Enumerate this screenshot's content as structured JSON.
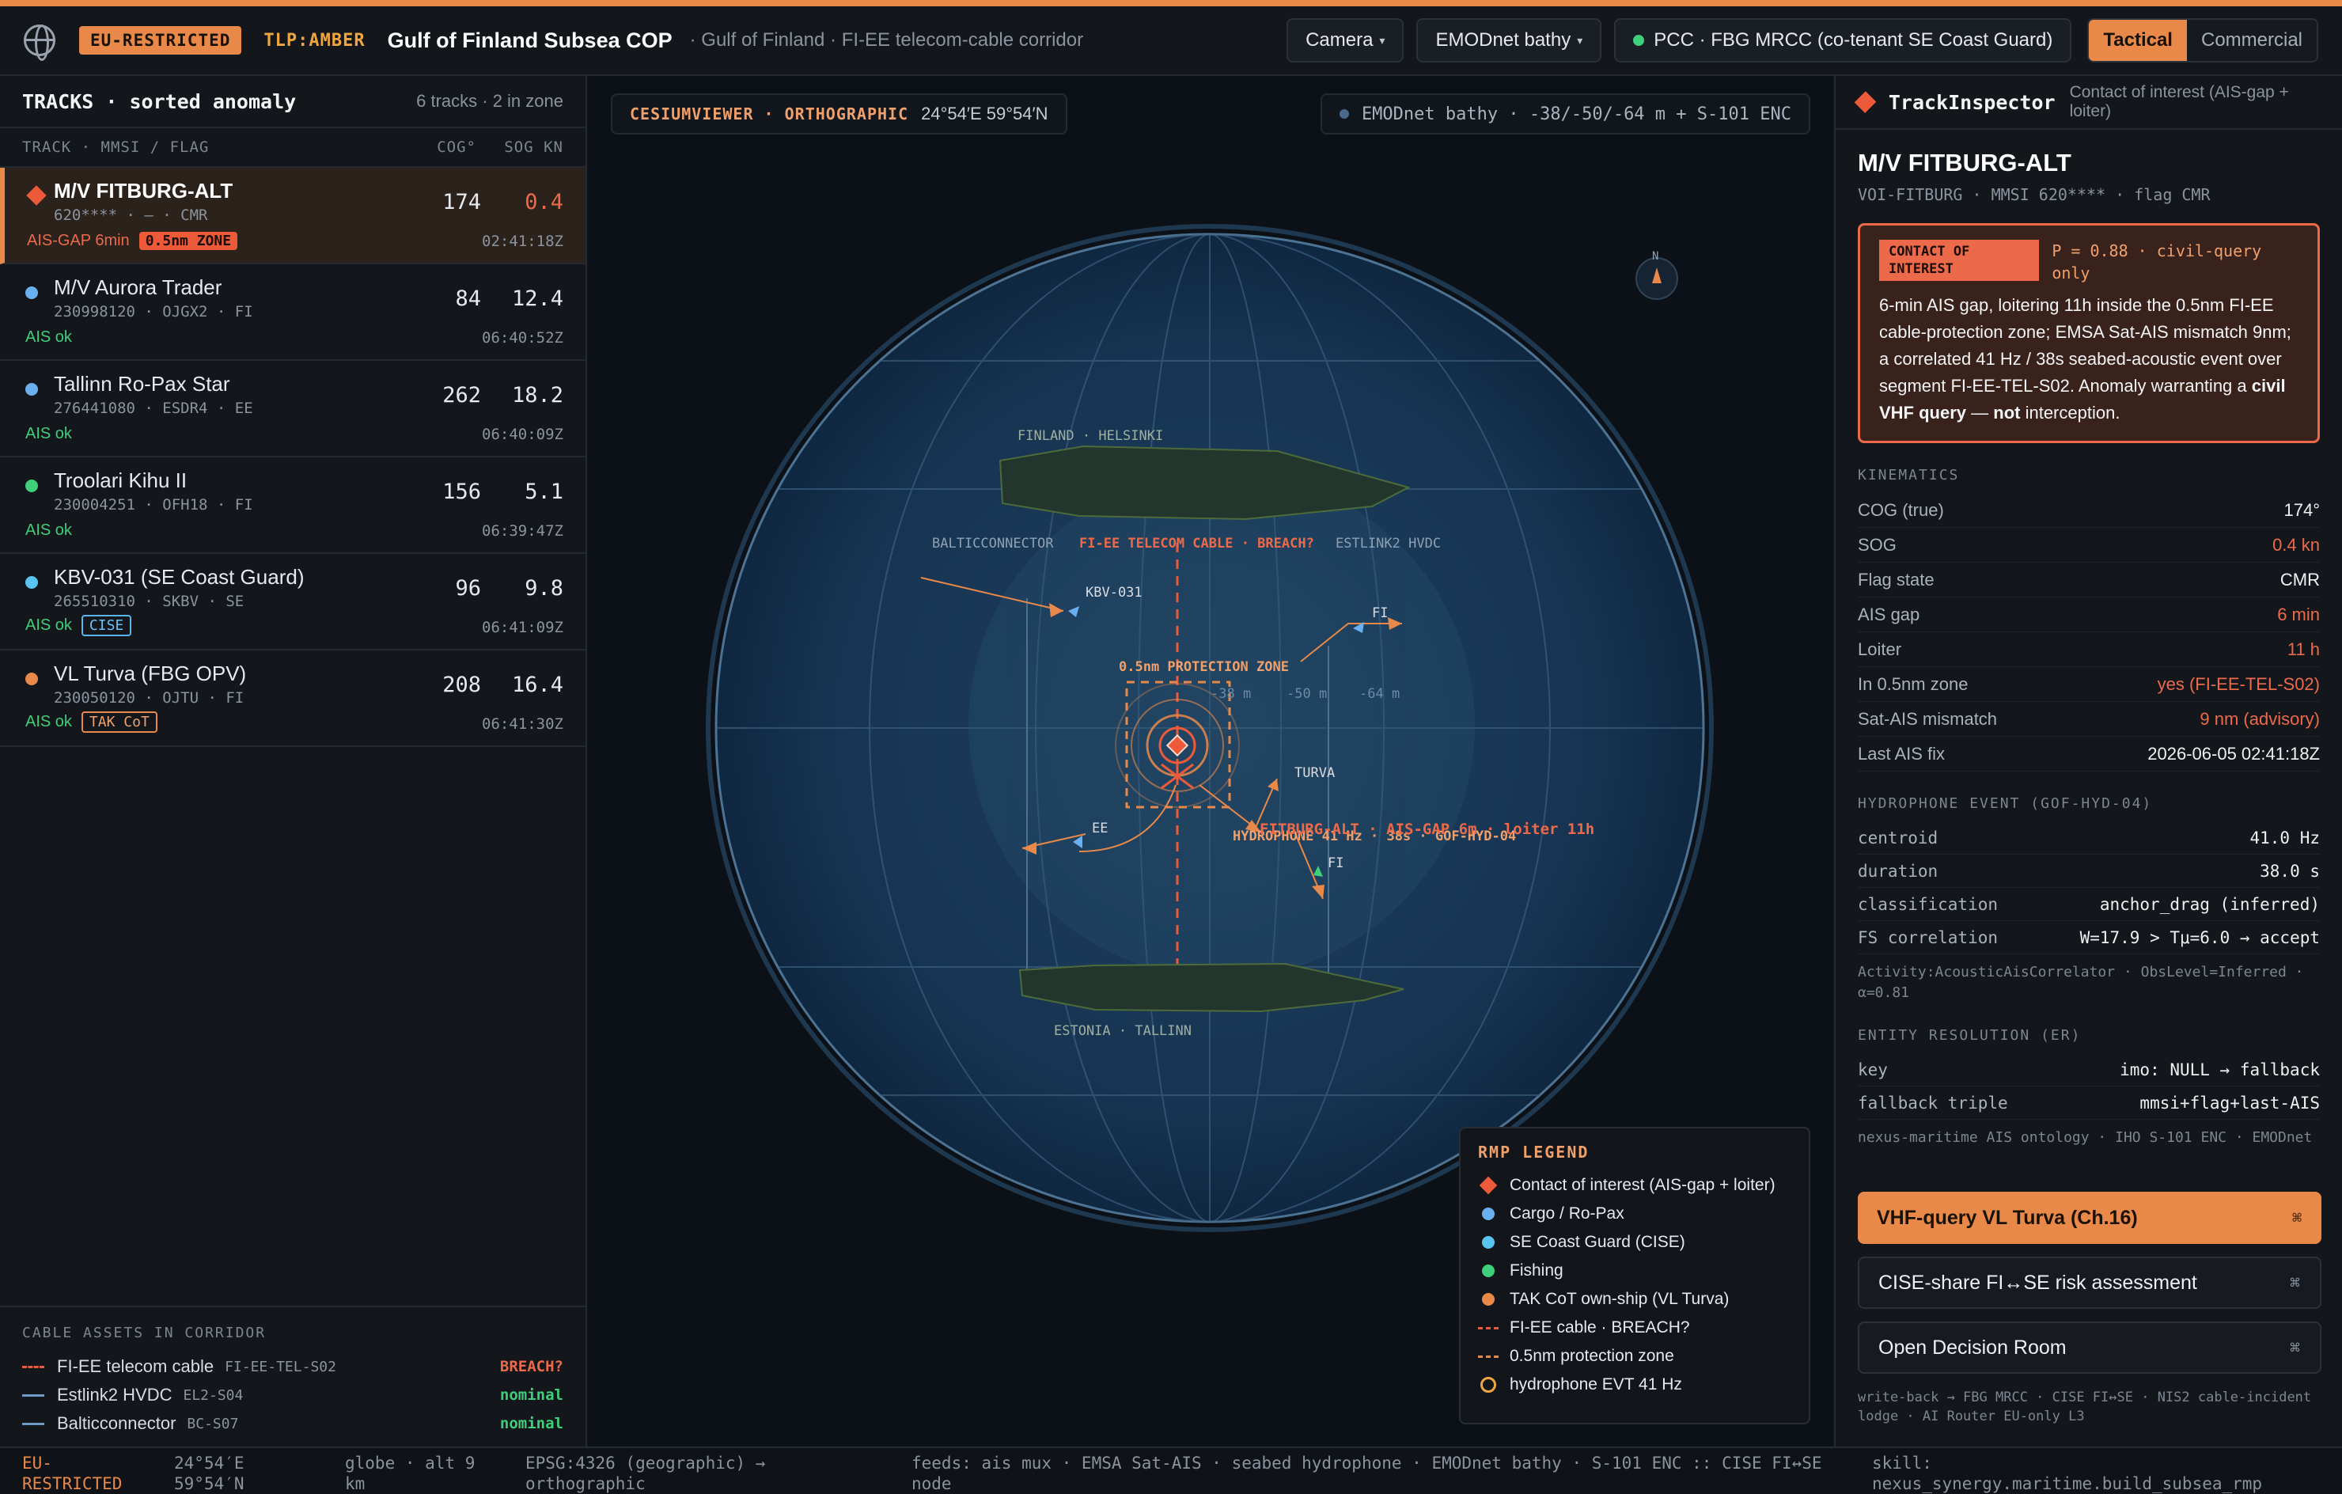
{
  "header": {
    "restricted": "EU-RESTRICTED",
    "tlp": "TLP:AMBER",
    "title": "Gulf of Finland Subsea COP",
    "subtitle": "· Gulf of Finland · FI-EE telecom-cable corridor",
    "camera": "Camera",
    "bathy": "EMODnet bathy",
    "pcc": "PCC · FBG MRCC (co-tenant SE Coast Guard)",
    "mode_tactical": "Tactical",
    "mode_commercial": "Commercial"
  },
  "tracks": {
    "title": "TRACKS · sorted anomaly",
    "summary": "6 tracks · 2 in zone",
    "col_track": "TRACK · MMSI / FLAG",
    "col_cog": "COG°",
    "col_sog": "SOG KN",
    "items": [
      {
        "name": "M/V FITBURG-ALT",
        "meta": "620**** · — · CMR",
        "cog": "174",
        "sog": "0.4",
        "status": "AIS-GAP 6min",
        "tag": "0.5nm ZONE",
        "time": "02:41:18Z"
      },
      {
        "name": "M/V Aurora Trader",
        "meta": "230998120 · OJGX2 · FI",
        "cog": "84",
        "sog": "12.4",
        "status": "AIS ok",
        "tag": "",
        "time": "06:40:52Z"
      },
      {
        "name": "Tallinn Ro-Pax Star",
        "meta": "276441080 · ESDR4 · EE",
        "cog": "262",
        "sog": "18.2",
        "status": "AIS ok",
        "tag": "",
        "time": "06:40:09Z"
      },
      {
        "name": "Troolari Kihu II",
        "meta": "230004251 · OFH18 · FI",
        "cog": "156",
        "sog": "5.1",
        "status": "AIS ok",
        "tag": "",
        "time": "06:39:47Z"
      },
      {
        "name": "KBV-031 (SE Coast Guard)",
        "meta": "265510310 · SKBV · SE",
        "cog": "96",
        "sog": "9.8",
        "status": "AIS ok",
        "tag": "CISE",
        "time": "06:41:09Z"
      },
      {
        "name": "VL Turva (FBG OPV)",
        "meta": "230050120 · OJTU · FI",
        "cog": "208",
        "sog": "16.4",
        "status": "AIS ok",
        "tag": "TAK CoT",
        "time": "06:41:30Z"
      }
    ]
  },
  "cables": {
    "title": "CABLE ASSETS IN CORRIDOR",
    "items": [
      {
        "name": "FI-EE telecom cable",
        "id": "FI-EE-TEL-S02",
        "status": "BREACH?"
      },
      {
        "name": "Estlink2 HVDC",
        "id": "EL2-S04",
        "status": "nominal"
      },
      {
        "name": "Balticconnector",
        "id": "BC-S07",
        "status": "nominal"
      }
    ]
  },
  "map": {
    "viewer": "CESIUMVIEWER · ORTHOGRAPHIC",
    "coords": "24°54′E 59°54′N",
    "layer": "EMODnet bathy · -38/-50/-64 m + S-101 ENC",
    "north": "N",
    "labels": {
      "finland": "FINLAND · HELSINKI",
      "estonia": "ESTONIA · TALLINN",
      "balticconnector": "BALTICCONNECTOR",
      "cable": "FI-EE TELECOM CABLE · BREACH?",
      "estlink": "ESTLINK2 HVDC",
      "zone": "0.5nm PROTECTION ZONE",
      "d38": "-38 m",
      "d50": "-50 m",
      "d64": "-64 m",
      "kbv": "KBV-031",
      "fi1": "FI",
      "turva": "TURVA",
      "ee": "EE",
      "fi2": "FI",
      "hydro": "HYDROPHONE 41 Hz · 38s · GOF-HYD-04",
      "fitburg": "FITBURG-ALT · AIS-GAP 6m · loiter 11h"
    }
  },
  "legend": {
    "title": "RMP LEGEND",
    "items": [
      "Contact of interest (AIS-gap + loiter)",
      "Cargo / Ro-Pax",
      "SE Coast Guard (CISE)",
      "Fishing",
      "TAK CoT own-ship (VL Turva)",
      "FI-EE cable · BREACH?",
      "0.5nm protection zone",
      "hydrophone EVT 41 Hz"
    ]
  },
  "inspector": {
    "title": "TrackInspector",
    "subtitle": "Contact of interest (AIS-gap + loiter)",
    "vessel": "M/V FITBURG-ALT",
    "vessel_sub": "VOI-FITBURG · MMSI 620**** · flag CMR",
    "alert_label": "CONTACT OF INTEREST",
    "alert_p": "P = 0.88 · civil-query only",
    "alert_text_a": "6-min AIS gap, loitering 11h inside the 0.5nm FI-EE cable-protection zone; EMSA Sat-AIS mismatch 9nm; a correlated 41 Hz / 38s seabed-acoustic event over segment FI-EE-TEL-S02. Anomaly warranting a ",
    "alert_text_b": "civil VHF query",
    "alert_text_c": " — ",
    "alert_text_d": "not",
    "alert_text_e": " interception.",
    "kin_title": "KINEMATICS",
    "kin": [
      {
        "k": "COG (true)",
        "v": "174°"
      },
      {
        "k": "SOG",
        "v": "0.4 kn"
      },
      {
        "k": "Flag state",
        "v": "CMR"
      },
      {
        "k": "AIS gap",
        "v": "6 min"
      },
      {
        "k": "Loiter",
        "v": "11 h"
      },
      {
        "k": "In 0.5nm zone",
        "v": "yes (FI-EE-TEL-S02)"
      },
      {
        "k": "Sat-AIS mismatch",
        "v": "9 nm (advisory)"
      },
      {
        "k": "Last AIS fix",
        "v": "2026-06-05 02:41:18Z"
      }
    ],
    "hyd_title": "HYDROPHONE EVENT (GOF-HYD-04)",
    "hyd": [
      {
        "k": "centroid",
        "v": "41.0 Hz"
      },
      {
        "k": "duration",
        "v": "38.0 s"
      },
      {
        "k": "classification",
        "v": "anchor_drag (inferred)"
      },
      {
        "k": "FS correlation",
        "v": "W=17.9 > Tμ=6.0 → accept"
      }
    ],
    "hyd_note": "Activity:AcousticAisCorrelator · ObsLevel=Inferred · α=0.81",
    "er_title": "ENTITY RESOLUTION (ER)",
    "er": [
      {
        "k": "key",
        "v": "imo: NULL → fallback"
      },
      {
        "k": "fallback triple",
        "v": "mmsi+flag+last-AIS"
      }
    ],
    "er_note": "nexus-maritime AIS ontology · IHO S-101 ENC · EMODnet",
    "btn_vhf": "VHF-query VL Turva (Ch.16)",
    "btn_cise": "CISE-share FI↔SE risk assessment",
    "btn_room": "Open Decision Room",
    "kbd": "⌘",
    "writeback": "write-back → FBG MRCC · CISE FI↔SE · NIS2 cable-incident lodge · AI Router EU-only L3"
  },
  "status": {
    "restricted": "EU-RESTRICTED",
    "coords": "24°54′E 59°54′N",
    "globe": "globe · alt 9 km",
    "epsg": "EPSG:4326 (geographic) → orthographic",
    "feeds": "feeds: ais mux · EMSA Sat-AIS · seabed hydrophone · EMODnet bathy · S-101 ENC :: CISE FI↔SE node",
    "skill": "skill: nexus_synergy.maritime.build_subsea_rmp"
  },
  "colors": {
    "accent": "#e8894a",
    "alert": "#ec5a3a",
    "cargo": "#6ab0f0",
    "coastguard": "#5ac4f0",
    "fishing": "#3ecf7a",
    "ownship": "#e8894a"
  }
}
